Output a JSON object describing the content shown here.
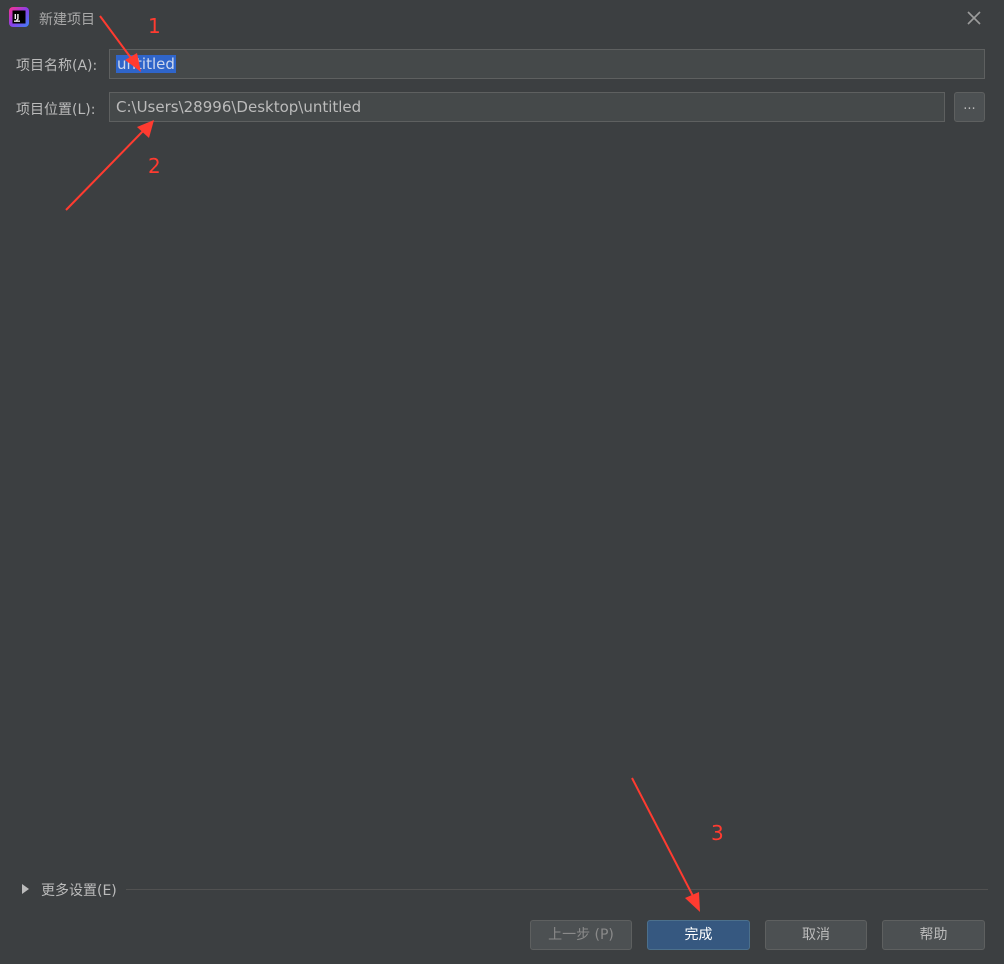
{
  "window": {
    "title": "新建项目"
  },
  "form": {
    "name_label": "项目名称(A):",
    "name_value": "untitled",
    "location_label": "项目位置(L):",
    "location_value": "C:\\Users\\28996\\Desktop\\untitled",
    "browse_label": "..."
  },
  "more_settings": {
    "label": "更多设置(E)"
  },
  "buttons": {
    "prev": "上一步 (P)",
    "finish": "完成",
    "cancel": "取消",
    "help": "帮助"
  },
  "annotations": {
    "a1": "1",
    "a2": "2",
    "a3": "3",
    "color": "#ff3b30"
  },
  "icons": {
    "app": "intellij-idea-icon",
    "close": "close-icon",
    "expand": "triangle-right-icon"
  }
}
